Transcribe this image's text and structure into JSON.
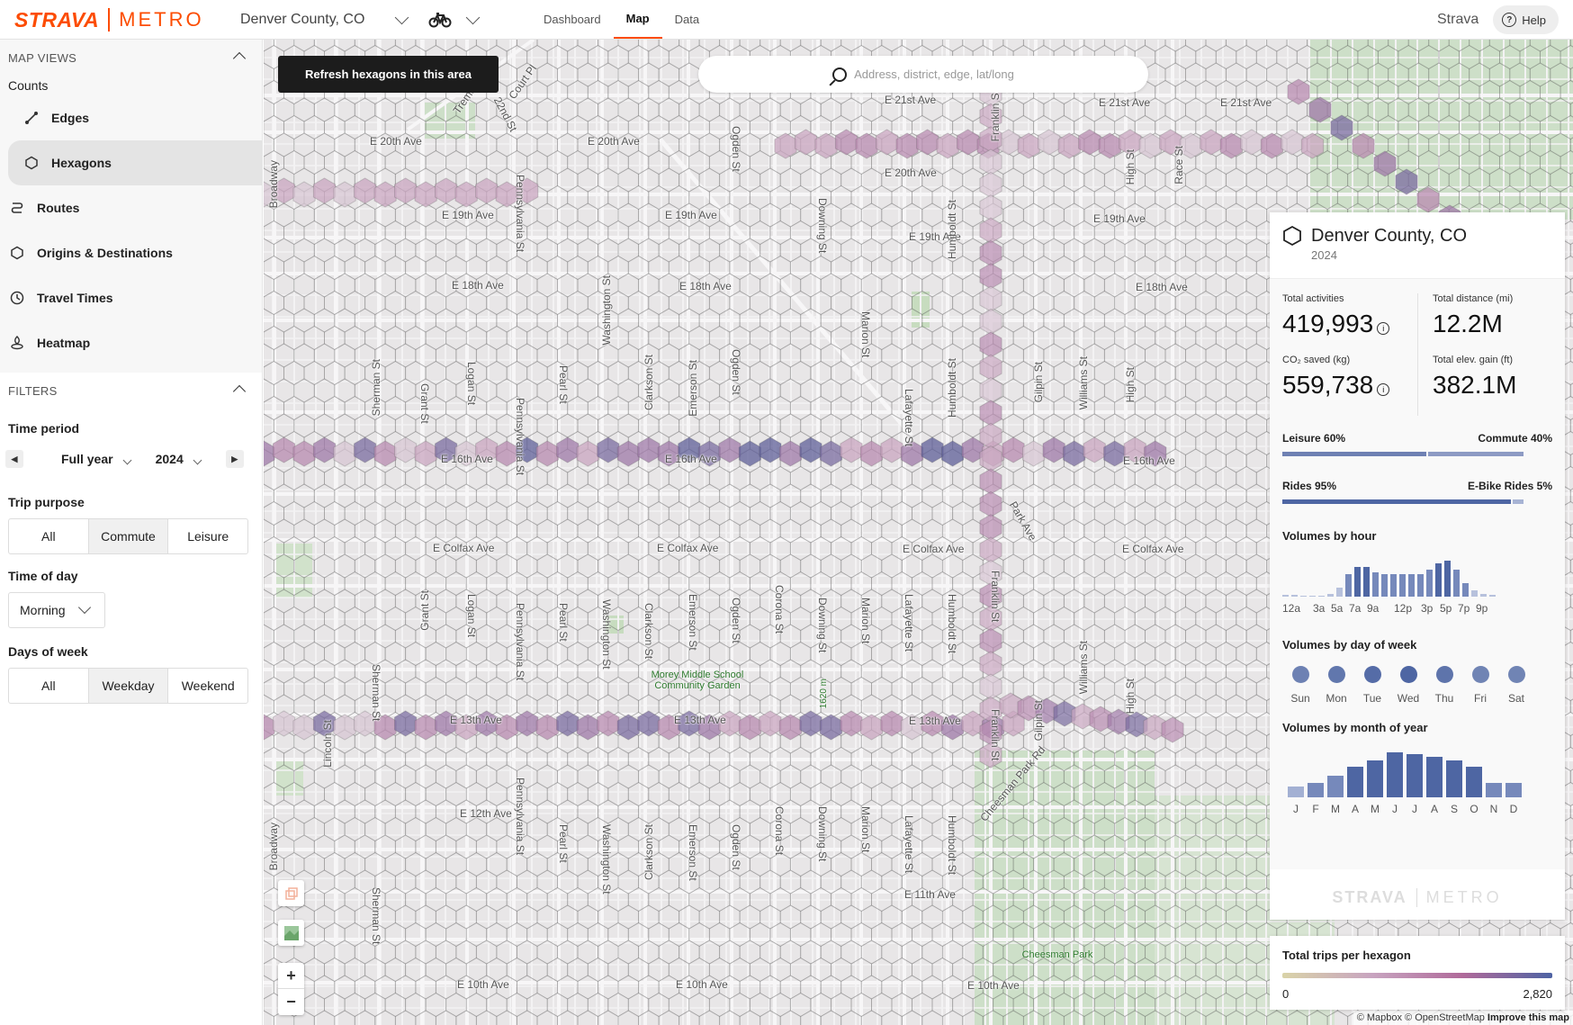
{
  "header": {
    "logo_strava": "STRAVA",
    "logo_metro": "METRO",
    "region": "Denver County, CO",
    "nav_tabs": [
      {
        "label": "Dashboard"
      },
      {
        "label": "Map"
      },
      {
        "label": "Data"
      }
    ],
    "strava_link": "Strava",
    "help_label": "Help"
  },
  "sidebar": {
    "map_views_title": "MAP VIEWS",
    "counts_label": "Counts",
    "items": [
      {
        "label": "Edges"
      },
      {
        "label": "Hexagons"
      },
      {
        "label": "Routes"
      },
      {
        "label": "Origins & Destinations"
      },
      {
        "label": "Travel Times"
      },
      {
        "label": "Heatmap"
      }
    ],
    "filters_title": "FILTERS",
    "time_period_label": "Time period",
    "period": "Full year",
    "year": "2024",
    "trip_purpose_label": "Trip purpose",
    "trip_purpose_options": [
      "All",
      "Commute",
      "Leisure"
    ],
    "time_of_day_label": "Time of day",
    "time_of_day": "Morning",
    "days_of_week_label": "Days of week",
    "days_options": [
      "All",
      "Weekday",
      "Weekend"
    ]
  },
  "map": {
    "refresh_label": "Refresh hexagons in this area",
    "search_placeholder": "Address, district, edge, lat/long",
    "streets": {
      "e21": "E 21st Ave",
      "e20": "E 20th Ave",
      "e19": "E 19th Ave",
      "e18": "E 18th Ave",
      "e16": "E 16th Ave",
      "colfax": "E Colfax Ave",
      "e13": "E 13th Ave",
      "e12": "E 12th Ave",
      "e11": "E 11th Ave",
      "e10": "E 10th Ave",
      "broadway": "Broadway",
      "sherman": "Sherman St",
      "grant": "Grant St",
      "logan": "Logan St",
      "penn": "Pennsylvania St",
      "pearl": "Pearl St",
      "washington": "Washington St",
      "clarkson": "Clarkson St",
      "emerson": "Emerson St",
      "ogden": "Ogden St",
      "corona": "Corona St",
      "downing": "Downing St",
      "marion": "Marion St",
      "lafayette": "Lafayette St",
      "humboldt": "Humboldt St",
      "franklin": "Franklin St",
      "gilpin": "Gilpin St",
      "williams": "Williams St",
      "high": "High St",
      "race": "Race St",
      "lincoln": "Lincoln St",
      "park_ave": "Park Ave",
      "cheesman_rd": "Cheesman Park Rd",
      "court_pl": "Court Pl",
      "tremont": "Tremont",
      "st22": "22nd St"
    },
    "poi_morey": "Morey Middle School Community Garden",
    "poi_cheesman": "Cheesman Park",
    "elevation": "1620 m",
    "attribution_1": "© Mapbox © OpenStreetMap",
    "attribution_2": "Improve this map",
    "zoom_in": "+",
    "zoom_out": "−"
  },
  "panel": {
    "title": "Denver County, CO",
    "year": "2024",
    "stats": {
      "total_activities_label": "Total activities",
      "total_activities": "419,993",
      "total_distance_label": "Total distance (mi)",
      "total_distance": "12.2M",
      "co2_label": "CO₂ saved (kg)",
      "co2": "559,738",
      "elev_label": "Total elev. gain (ft)",
      "elev": "382.1M"
    },
    "leisure_label": "Leisure 60%",
    "commute_label": "Commute 40%",
    "leisure_pct": 60,
    "rides_label": "Rides 95%",
    "ebike_label": "E-Bike Rides 5%",
    "rides_pct": 95,
    "hour_title": "Volumes by hour",
    "hour_values": [
      3,
      2,
      1,
      1,
      1,
      4,
      12,
      30,
      40,
      40,
      32,
      30,
      30,
      30,
      30,
      30,
      36,
      44,
      48,
      36,
      18,
      8,
      4,
      2
    ],
    "hour_labels": [
      "12a",
      "3a",
      "5a",
      "7a",
      "9a",
      "12p",
      "3p",
      "5p",
      "7p",
      "9p"
    ],
    "dow_title": "Volumes by day of week",
    "dow": [
      {
        "label": "Sun",
        "value": 0.6
      },
      {
        "label": "Mon",
        "value": 0.75
      },
      {
        "label": "Tue",
        "value": 0.9
      },
      {
        "label": "Wed",
        "value": 1.0
      },
      {
        "label": "Thu",
        "value": 0.8
      },
      {
        "label": "Fri",
        "value": 0.55
      },
      {
        "label": "Sat",
        "value": 0.55
      }
    ],
    "month_title": "Volumes by month of year",
    "month_values": [
      14,
      18,
      27,
      38,
      46,
      56,
      54,
      50,
      46,
      38,
      18,
      18
    ],
    "month_labels": [
      "J",
      "F",
      "M",
      "A",
      "M",
      "J",
      "J",
      "A",
      "S",
      "O",
      "N",
      "D"
    ],
    "watermark": "STRAVA",
    "watermark_metro": "METRO"
  },
  "legend": {
    "title": "Total trips per hexagon",
    "min": "0",
    "max": "2,820"
  },
  "colors": {
    "brand": "#fc4c02",
    "accent_blue": "#4e66a3",
    "hex_low": "#d9c4d0",
    "hex_high": "#6b5a95"
  }
}
